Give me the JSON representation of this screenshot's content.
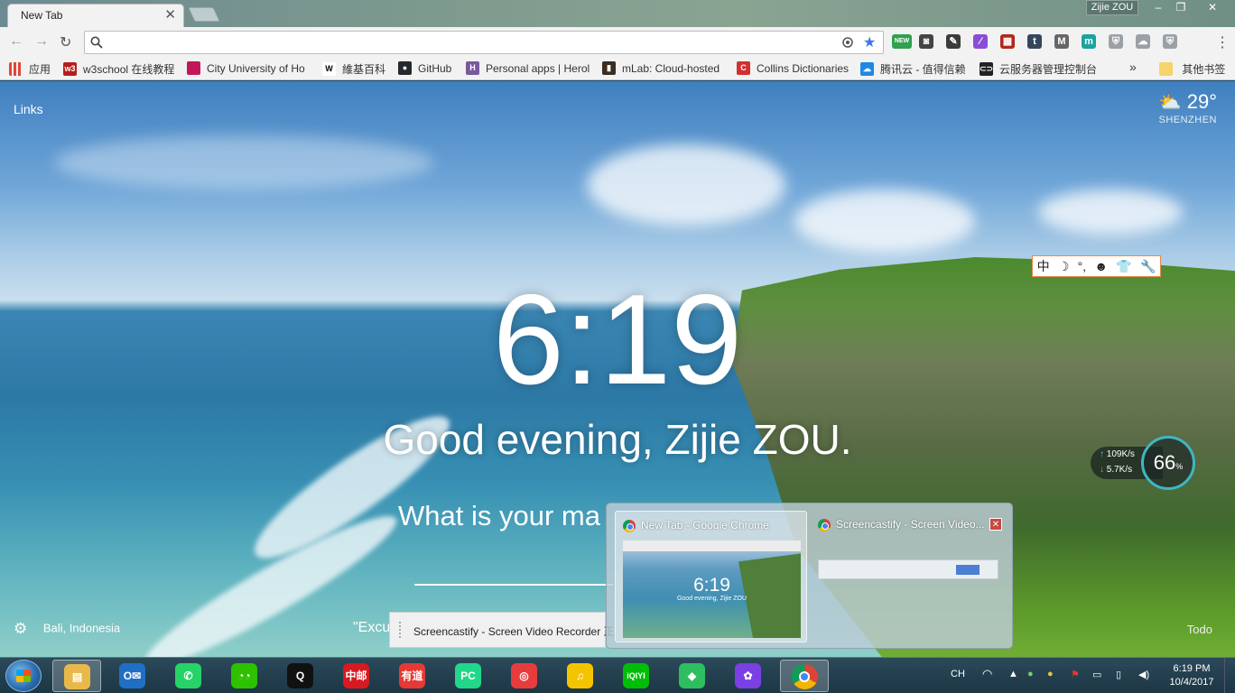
{
  "browser": {
    "tab_title": "New Tab",
    "tab_close": "✕",
    "profile_name": "Zijie ZOU",
    "window_buttons": {
      "minimize": "–",
      "maximize": "❐",
      "close": "✕"
    },
    "omnibox": {
      "value": "",
      "placeholder": ""
    },
    "extensions": [
      {
        "name": "new-badge-extension",
        "label": "NEW",
        "color": "#2fa14f"
      },
      {
        "name": "pocket-extension",
        "label": "◙",
        "color": "#444444"
      },
      {
        "name": "evernote-extension",
        "label": "✎",
        "color": "#3b3b3b"
      },
      {
        "name": "feather-extension",
        "label": "∕",
        "color": "#8a4dd6"
      },
      {
        "name": "film-extension",
        "label": "▦",
        "color": "#b3261e"
      },
      {
        "name": "tumblr-extension",
        "label": "t",
        "color": "#35465c"
      },
      {
        "name": "gmail-extension",
        "label": "M",
        "color": "#666666"
      },
      {
        "name": "m-extension",
        "label": "m",
        "color": "#1ba39c"
      },
      {
        "name": "shield-extension",
        "label": "⛨",
        "color": "#9aa0a6"
      },
      {
        "name": "cloud-extension",
        "label": "☁",
        "color": "#9aa0a6"
      },
      {
        "name": "shield-2-extension",
        "label": "⛨",
        "color": "#9aa0a6"
      }
    ]
  },
  "bookmarks": [
    {
      "label": "应用",
      "icon": "apps-grid-icon",
      "color": "#d93025"
    },
    {
      "label": "w3school 在线教程",
      "icon": "w3-icon",
      "color": "#b71c1c",
      "text": "w3"
    },
    {
      "label": "City University of Ho",
      "icon": "cityu-icon",
      "color": "#c2185b",
      "text": ""
    },
    {
      "label": "維基百科",
      "icon": "wikipedia-icon",
      "color": "#ffffff",
      "text": "W"
    },
    {
      "label": "GitHub",
      "icon": "github-icon",
      "color": "#24292e",
      "text": "●"
    },
    {
      "label": "Personal apps | Herol",
      "icon": "heroku-icon",
      "color": "#79589f",
      "text": "H"
    },
    {
      "label": "mLab: Cloud-hosted",
      "icon": "mlab-icon",
      "color": "#3b2d1f",
      "text": "▮"
    },
    {
      "label": "Collins Dictionaries",
      "icon": "collins-icon",
      "color": "#d32f2f",
      "text": "C"
    },
    {
      "label": "腾讯云 - 值得信赖",
      "icon": "tencent-cloud-icon",
      "color": "#1e88e5",
      "text": "☁"
    },
    {
      "label": "云服务器管理控制台",
      "icon": "cloud-console-icon",
      "color": "#222222",
      "text": "⊂⊃"
    }
  ],
  "bookmarks_overflow": "»",
  "other_bookmarks": "其他书签",
  "momentum": {
    "links": "Links",
    "weather_temp": "29°",
    "weather_city": "SHENZHEN",
    "clock": "6:19",
    "greeting": "Good evening, Zijie ZOU.",
    "focus_question": "What is your ma",
    "quote": "\"Excu",
    "location": "Bali, Indonesia",
    "todo": "Todo"
  },
  "ime_toolbar": [
    "中",
    "☽",
    "°,",
    "☻",
    "👕",
    "🔧"
  ],
  "net_meter": {
    "up": "109K/s",
    "down": "5.7K/s",
    "percent": "66",
    "percent_unit": "%"
  },
  "download_chip": "Screencastify - Screen Video Recorder 正",
  "thumbnails": [
    {
      "title": "New Tab - Google Chrome",
      "clock": "6:19",
      "greeting": "Good evening, Zijie ZOU"
    },
    {
      "title": "Screencastify - Screen Video...",
      "close": "✕"
    }
  ],
  "taskbar": {
    "apps": [
      {
        "name": "file-explorer-icon",
        "label": "▤",
        "color": "#e8b94a"
      },
      {
        "name": "outlook-icon",
        "label": "O✉",
        "color": "#1f6fc5"
      },
      {
        "name": "whatsapp-icon",
        "label": "✆",
        "color": "#25d366"
      },
      {
        "name": "wechat-icon",
        "label": "◔◔",
        "color": "#2dc100"
      },
      {
        "name": "qq-icon",
        "label": "Q",
        "color": "#111111"
      },
      {
        "name": "china-post-icon",
        "label": "中邮",
        "color": "#d71920"
      },
      {
        "name": "youdao-icon",
        "label": "有道",
        "color": "#e53935"
      },
      {
        "name": "pycharm-icon",
        "label": "PC",
        "color": "#21d789"
      },
      {
        "name": "netease-music-icon",
        "label": "◎",
        "color": "#e83c3c"
      },
      {
        "name": "music-player-icon",
        "label": "♫",
        "color": "#f5c400"
      },
      {
        "name": "iqiyi-icon",
        "label": "iQIYI",
        "color": "#00be06"
      },
      {
        "name": "evernote-icon",
        "label": "◆",
        "color": "#2dbe60"
      },
      {
        "name": "flower-app-icon",
        "label": "✿",
        "color": "#7b3fe4"
      },
      {
        "name": "chrome-icon",
        "label": "",
        "color": "#4285f4"
      }
    ],
    "lang": "CH",
    "time": "6:19 PM",
    "date": "10/4/2017"
  }
}
